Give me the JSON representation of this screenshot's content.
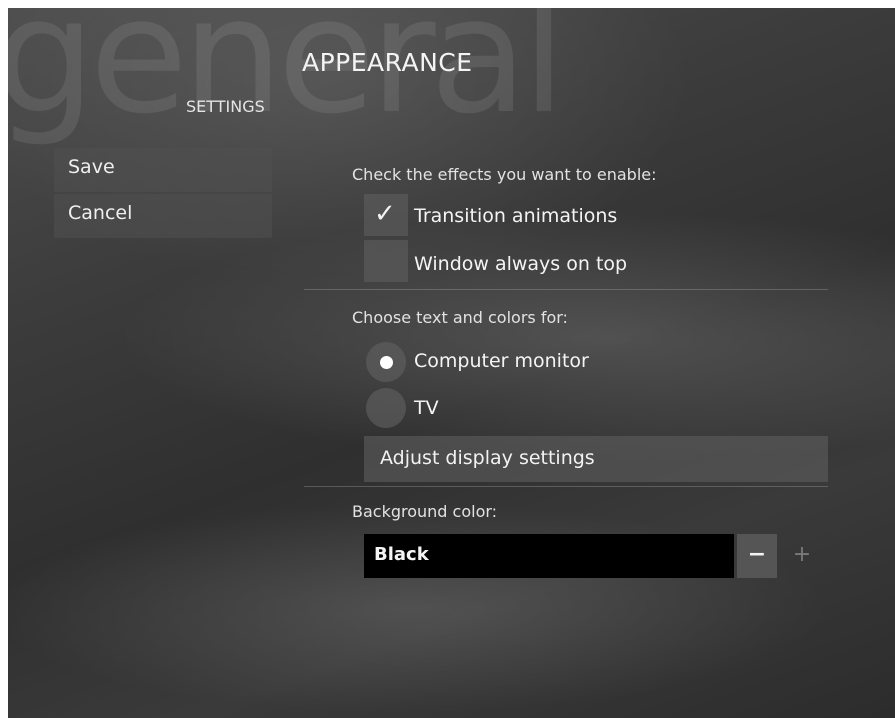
{
  "page": {
    "watermark": "general",
    "title": "APPEARANCE",
    "subtitle": "SETTINGS"
  },
  "sidebar": {
    "save_label": "Save",
    "cancel_label": "Cancel"
  },
  "effects": {
    "heading": "Check the effects you want to enable:",
    "options": [
      {
        "label": "Transition animations",
        "checked": true,
        "check_glyph": "✓"
      },
      {
        "label": "Window always on top",
        "checked": false
      }
    ]
  },
  "display": {
    "heading": "Choose text and colors for:",
    "options": [
      {
        "label": "Computer monitor",
        "selected": true
      },
      {
        "label": "TV",
        "selected": false
      }
    ],
    "adjust_label": "Adjust display settings"
  },
  "background": {
    "heading": "Background color:",
    "value": "Black",
    "decrement_label": "−",
    "increment_label": "+"
  },
  "colors": {
    "field_bg": "#000000",
    "text": "#f4f4f4"
  }
}
